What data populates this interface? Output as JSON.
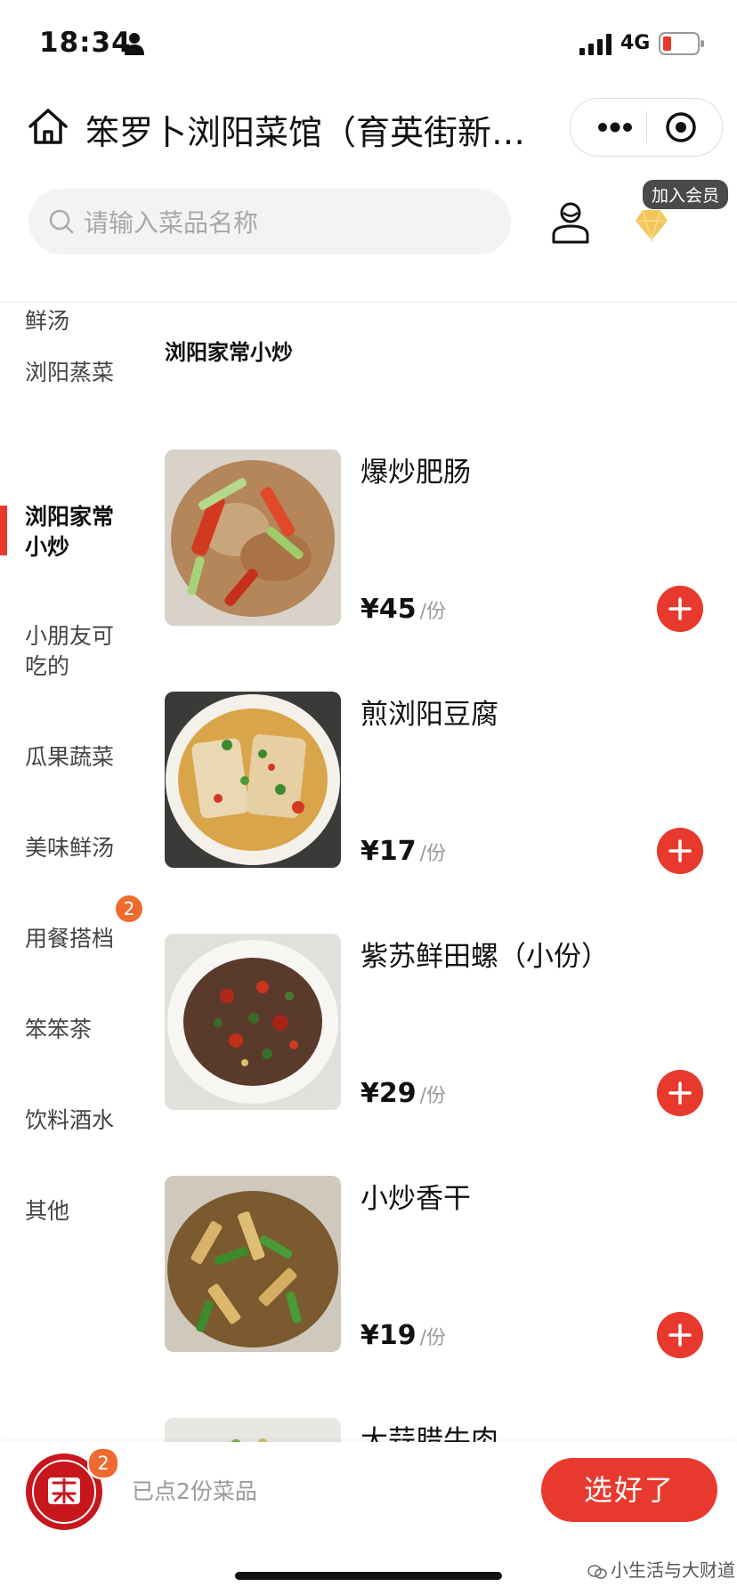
{
  "status_bar": {
    "time": "18:34",
    "network": "4G"
  },
  "header": {
    "shop_name": "笨罗卜浏阳菜馆（育英街新…",
    "search_placeholder": "请输入菜品名称",
    "member_tag": "加入会员"
  },
  "sidebar": {
    "items": [
      {
        "label": "今日蔬菜/鲜汤"
      },
      {
        "label": "浏阳蒸菜"
      },
      {
        "label": "浏阳家常小炒",
        "active": true
      },
      {
        "label": "小朋友可吃的"
      },
      {
        "label": "瓜果蔬菜"
      },
      {
        "label": "美味鲜汤"
      },
      {
        "label": "用餐搭档",
        "badge": "2"
      },
      {
        "label": "笨笨茶"
      },
      {
        "label": "饮料酒水"
      },
      {
        "label": "其他"
      }
    ]
  },
  "content": {
    "category_title": "浏阳家常小炒",
    "dishes": [
      {
        "name": "爆炒肥肠",
        "price": "¥45",
        "unit": "/份"
      },
      {
        "name": "煎浏阳豆腐",
        "price": "¥17",
        "unit": "/份"
      },
      {
        "name": "紫苏鲜田螺（小份）",
        "price": "¥29",
        "unit": "/份"
      },
      {
        "name": "小炒香干",
        "price": "¥19",
        "unit": "/份"
      },
      {
        "name": "大蒜腊牛肉"
      }
    ]
  },
  "bottom_bar": {
    "cart_count": "2",
    "cart_text": "已点2份菜品",
    "checkout_label": "选好了"
  },
  "watermark": "小生活与大财道",
  "colors": {
    "accent": "#e8392e",
    "badge": "#ee6a2f",
    "member_gold": "#f3c55a"
  }
}
